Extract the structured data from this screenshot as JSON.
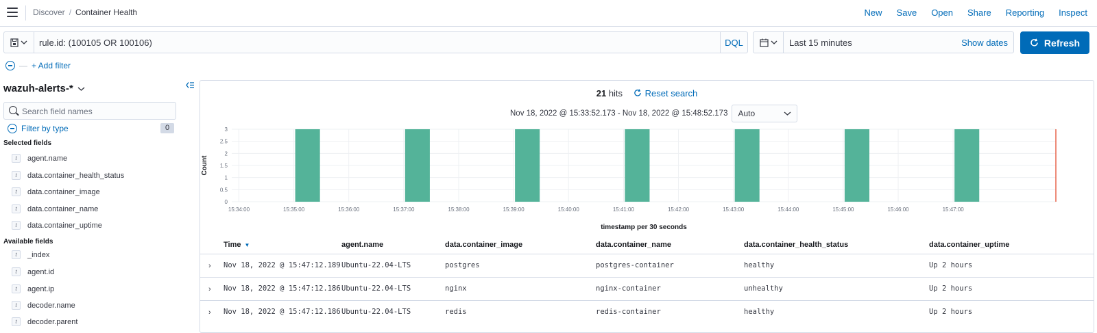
{
  "header": {
    "breadcrumbs": [
      "Discover",
      "Container Health"
    ],
    "nav": [
      "New",
      "Save",
      "Open",
      "Share",
      "Reporting",
      "Inspect"
    ]
  },
  "query": {
    "value": "rule.id: (100105 OR 100106)",
    "language": "DQL"
  },
  "date": {
    "range": "Last 15 minutes",
    "show_dates": "Show dates",
    "refresh": "Refresh"
  },
  "filters": {
    "add": "+ Add filter"
  },
  "sidebar": {
    "index_pattern": "wazuh-alerts-*",
    "search_placeholder": "Search field names",
    "filter_by_type": "Filter by type",
    "filter_count": "0",
    "selected_heading": "Selected fields",
    "selected_fields": [
      "agent.name",
      "data.container_health_status",
      "data.container_image",
      "data.container_name",
      "data.container_uptime"
    ],
    "available_heading": "Available fields",
    "available_fields": [
      "_index",
      "agent.id",
      "agent.ip",
      "decoder.name",
      "decoder.parent"
    ],
    "field_type": "t"
  },
  "results": {
    "hits": "21",
    "hits_label": "hits",
    "reset": "Reset search",
    "range": "Nov 18, 2022 @ 15:33:52.173 - Nov 18, 2022 @ 15:48:52.173",
    "interval": "Auto"
  },
  "chart_data": {
    "type": "bar",
    "xlabel": "timestamp per 30 seconds",
    "ylabel": "Count",
    "ylim": [
      0,
      3
    ],
    "yticks": [
      "0",
      "0.5",
      "1",
      "1.5",
      "2",
      "2.5",
      "3"
    ],
    "xticks": [
      "15:34:00",
      "15:35:00",
      "15:36:00",
      "15:37:00",
      "15:38:00",
      "15:39:00",
      "15:40:00",
      "15:41:00",
      "15:42:00",
      "15:43:00",
      "15:44:00",
      "15:45:00",
      "15:46:00",
      "15:47:00"
    ],
    "categories": [
      "15:35:00",
      "15:37:00",
      "15:39:00",
      "15:41:00",
      "15:43:00",
      "15:45:00",
      "15:47:00"
    ],
    "values": [
      3,
      3,
      3,
      3,
      3,
      3,
      3
    ],
    "bar_color": "#54b399",
    "now_marker_color": "#e7664c"
  },
  "table": {
    "columns": [
      "Time",
      "agent.name",
      "data.container_image",
      "data.container_name",
      "data.container_health_status",
      "data.container_uptime"
    ],
    "rows": [
      [
        "Nov 18, 2022 @ 15:47:12.189",
        "Ubuntu-22.04-LTS",
        "postgres",
        "postgres-container",
        "healthy",
        "Up 2 hours"
      ],
      [
        "Nov 18, 2022 @ 15:47:12.186",
        "Ubuntu-22.04-LTS",
        "nginx",
        "nginx-container",
        "unhealthy",
        "Up 2 hours"
      ],
      [
        "Nov 18, 2022 @ 15:47:12.186",
        "Ubuntu-22.04-LTS",
        "redis",
        "redis-container",
        "healthy",
        "Up 2 hours"
      ]
    ]
  },
  "colors": {
    "accent": "#006bb8",
    "border": "#d3dae6"
  }
}
